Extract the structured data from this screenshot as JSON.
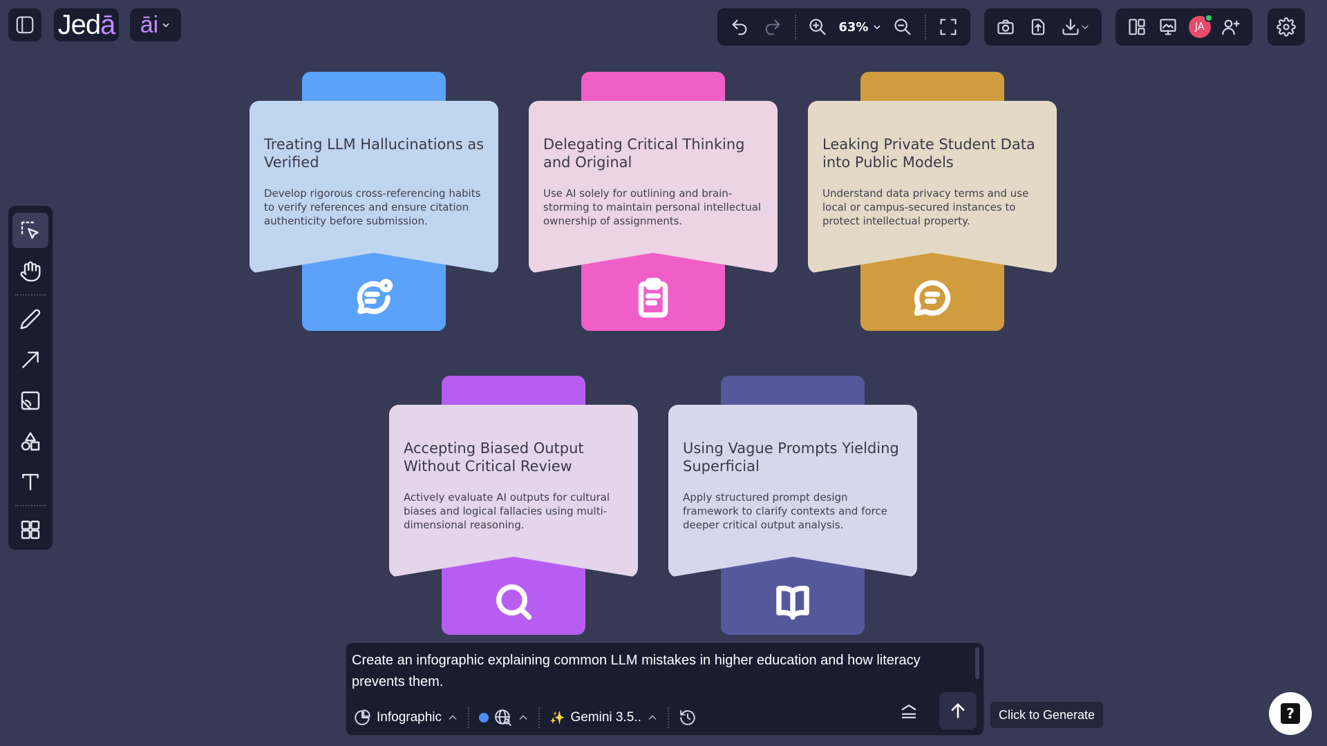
{
  "app": {
    "logo": "Jedā",
    "ai_menu_label": "āi"
  },
  "toolbar": {
    "zoom": "63%",
    "avatar_initials": "JA"
  },
  "cards": [
    {
      "title": "Treating LLM Hallucinations as Verified",
      "desc": "Develop rigorous cross-referencing habits to verify references and ensure citation authenticity before submission.",
      "icon": "chat-bubble-notification-icon",
      "color": "#5aa2fb",
      "bg": "#c0d5ef"
    },
    {
      "title": "Delegating Critical Thinking and Original",
      "desc": "Use AI solely for outlining and brain-storming to maintain personal intellectual ownership of assignments.",
      "icon": "clipboard-icon",
      "color": "#f05fc8",
      "bg": "#ecd4e4"
    },
    {
      "title": "Leaking Private Student Data into Public Models",
      "desc": "Understand data privacy terms and use local or campus-secured instances to protect intellectual property.",
      "icon": "chat-bubble-icon",
      "color": "#d09c3d",
      "bg": "#e4d9c6"
    },
    {
      "title": "Accepting Biased Output Without Critical Review",
      "desc": "Actively evaluate AI outputs for cultural biases and logical fallacies using multi-dimensional reasoning.",
      "icon": "search-icon",
      "color": "#b75ef2",
      "bg": "#e5d5ea"
    },
    {
      "title": "Using Vague Prompts Yielding Superficial",
      "desc": "Apply structured prompt design framework to clarify contexts and force deeper critical output analysis.",
      "icon": "book-icon",
      "color": "#55599c",
      "bg": "#d6d7ec"
    }
  ],
  "prompt": {
    "text": "Create an infographic explaining common LLM mistakes in higher education and how literacy prevents them.",
    "mode_label": "Infographic",
    "model_label": "Gemini 3.5..",
    "generate_tooltip": "Click to Generate"
  },
  "help": {
    "label": "?"
  }
}
